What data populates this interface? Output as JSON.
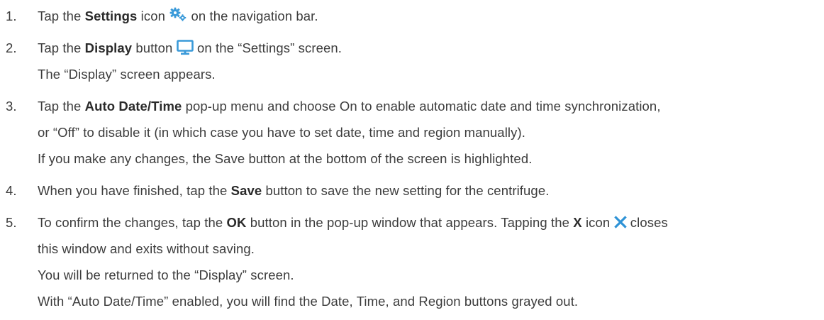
{
  "steps": [
    {
      "num": "1.",
      "pre": "Tap the",
      "bold": "Settings",
      "mid": "icon",
      "icon": "settings-gears-icon",
      "post": "on the navigation bar."
    },
    {
      "num": "2.",
      "pre": "Tap the",
      "bold": "Display",
      "mid": "button",
      "icon": "monitor-icon",
      "post": "on the “Settings” screen.",
      "extra": [
        "The “Display” screen appears."
      ]
    },
    {
      "num": "3.",
      "pre": "Tap the",
      "bold": "Auto Date/Time",
      "post": "pop-up menu and choose On to enable automatic date and time synchronization,",
      "extra": [
        "or “Off” to disable it (in which case you have to set date, time and region manually).",
        "If you make any changes, the Save button at the bottom of the screen is highlighted."
      ]
    },
    {
      "num": "4.",
      "pre": "When you have finished, tap the",
      "bold": "Save",
      "post": "button to save the new setting for the centrifuge."
    },
    {
      "num": "5.",
      "pre": "To confirm the changes, tap the",
      "bold": "OK",
      "mid": "button in the pop-up window that appears. Tapping the",
      "bold2": "X",
      "mid2": "icon",
      "icon": "close-x-icon",
      "post": "closes",
      "extra": [
        "this window and exits without saving.",
        "You will be returned to the “Display” screen.",
        "With “Auto Date/Time” enabled, you will find the Date, Time, and Region buttons grayed out."
      ]
    }
  ],
  "colors": {
    "text": "#3c3c3c",
    "icon_blue": "#3a9ad9",
    "close_blue": "#2f93d6"
  }
}
